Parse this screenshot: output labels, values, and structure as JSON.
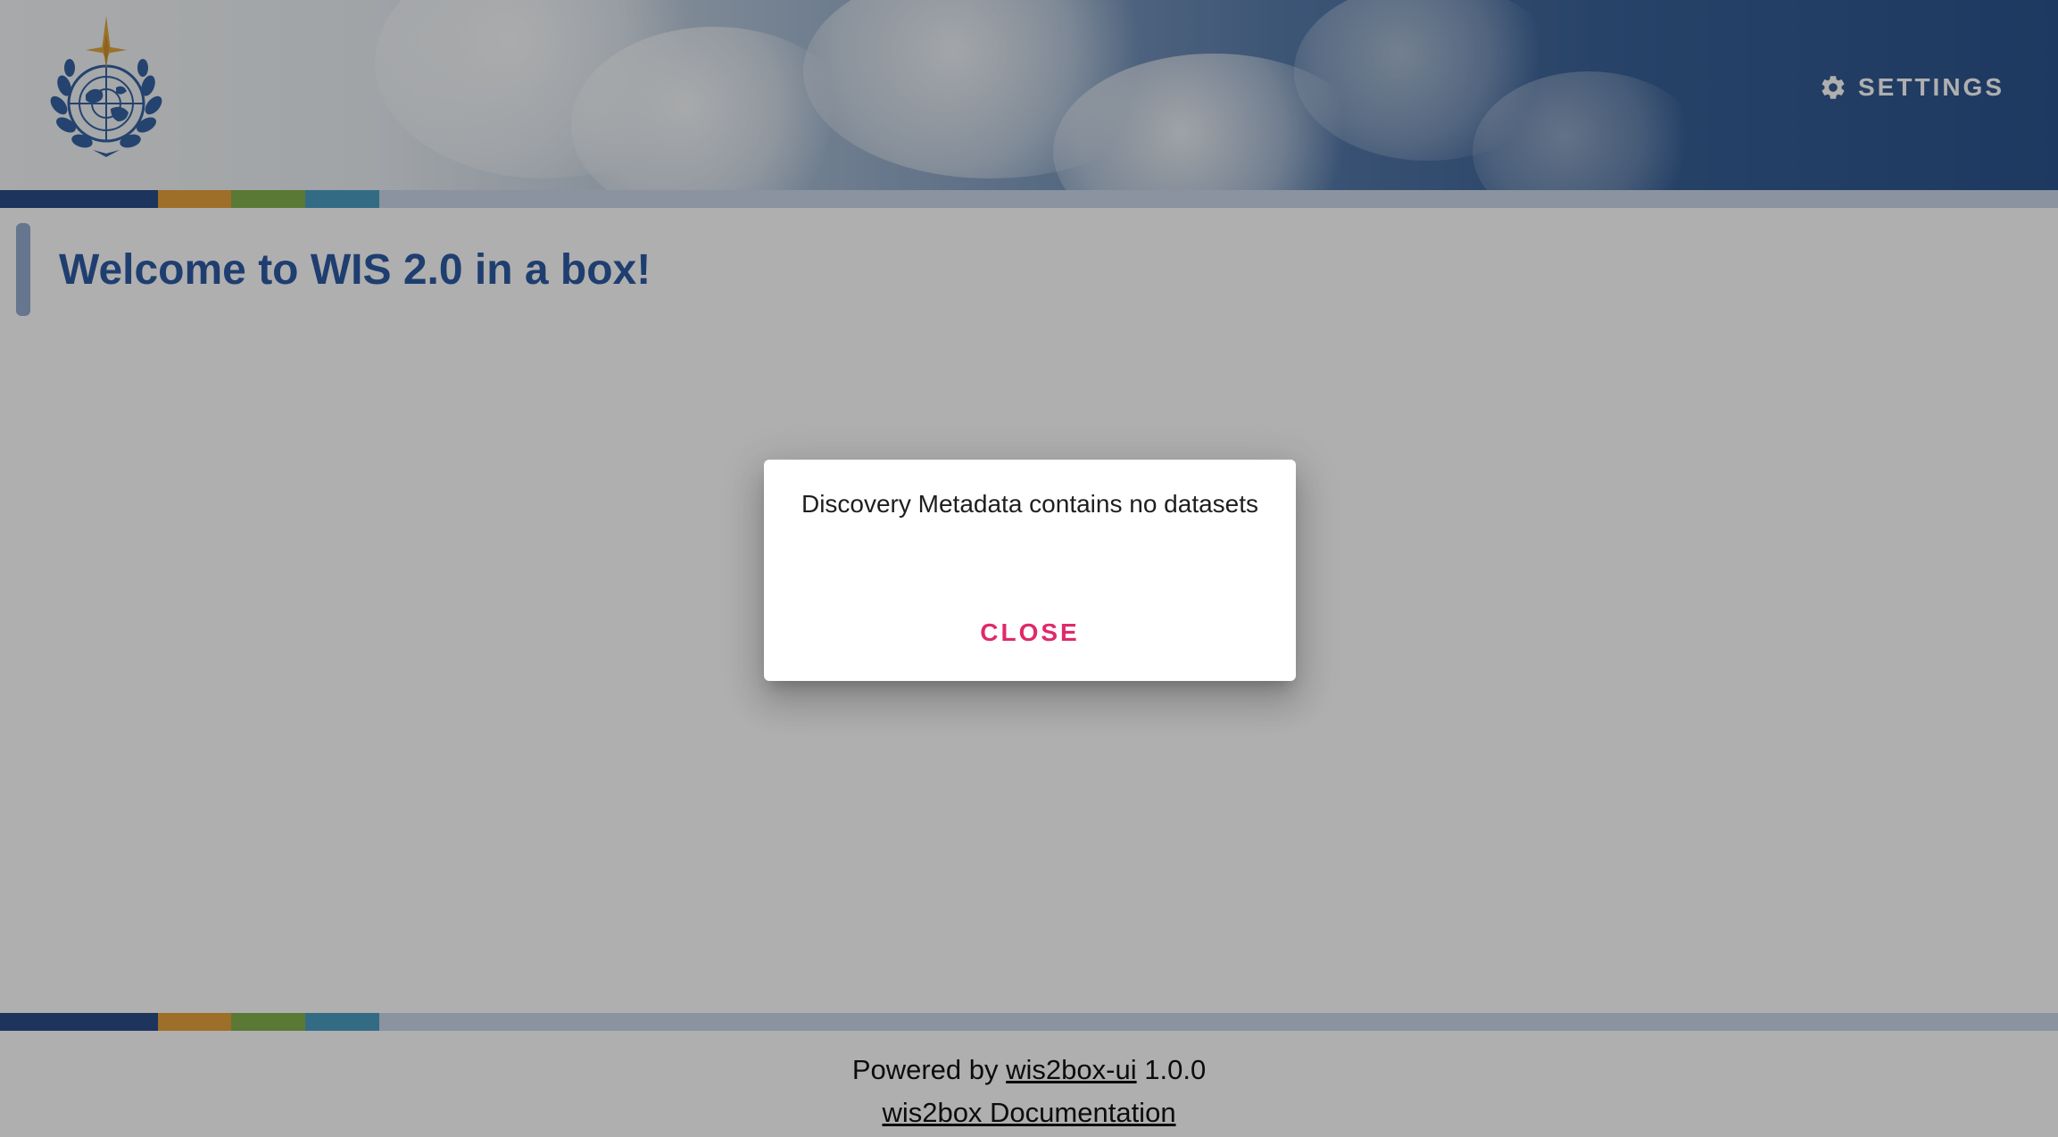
{
  "header": {
    "logo_icon": "wmo-emblem-icon",
    "settings": {
      "label": "SETTINGS",
      "icon": "gear-icon"
    }
  },
  "strip": {
    "colors": [
      "#1c3f7e",
      "#e39c2e",
      "#7bab3f",
      "#3e95bd",
      "#c6d4e6"
    ]
  },
  "main": {
    "title": "Welcome to WIS 2.0 in a box!"
  },
  "footer": {
    "powered_prefix": "Powered by",
    "ui_link": "wis2box-ui",
    "version": "1.0.0",
    "docs_link": "wis2box Documentation"
  },
  "dialog": {
    "message": "Discovery Metadata contains no datasets",
    "close_label": "CLOSE",
    "accent_color": "#e0296a"
  },
  "colors": {
    "title": "#1f4f9d",
    "overlay": "rgba(33,33,33,0.36)"
  }
}
